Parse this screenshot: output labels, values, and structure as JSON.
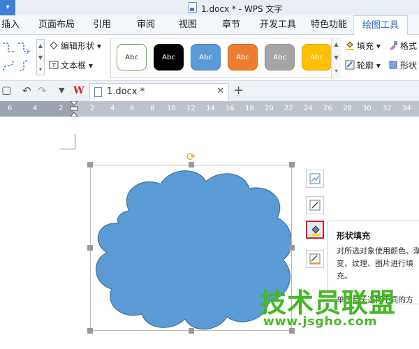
{
  "window": {
    "title": "1.docx * - WPS 文字"
  },
  "ribbon_tabs": [
    "插入",
    "页面布局",
    "引用",
    "审阅",
    "视图",
    "章节",
    "开发工具",
    "特色功能",
    "绘图工具"
  ],
  "active_tab": "绘图工具",
  "ribbon": {
    "edit_shape_label": "编辑形状",
    "textbox_label": "文本框",
    "fill_label": "填充",
    "format_label": "格式",
    "outline_label": "轮廓",
    "shape_effect_label": "形状",
    "style_samples": [
      {
        "label": "Abc",
        "fill": "#ffffff",
        "border": "#6aa84f",
        "text": "#333333"
      },
      {
        "label": "Abc",
        "fill": "#000000",
        "border": "#000000",
        "text": "#ffffff"
      },
      {
        "label": "Abc",
        "fill": "#5b9bd5",
        "border": "#4a86bf",
        "text": "#ffffff"
      },
      {
        "label": "Abc",
        "fill": "#ed7d31",
        "border": "#d66a20",
        "text": "#ffffff"
      },
      {
        "label": "Abc",
        "fill": "#a5a5a5",
        "border": "#8f8f8f",
        "text": "#ffffff"
      },
      {
        "label": "Abc",
        "fill": "#ffc000",
        "border": "#e0a800",
        "text": "#ffffff"
      }
    ]
  },
  "document_tab": {
    "name": "1.docx *"
  },
  "ruler": {
    "labels": [
      "6",
      "4",
      "2",
      "2",
      "4",
      "6",
      "8",
      "10",
      "12",
      "14",
      "16",
      "18",
      "20",
      "22",
      "24",
      "26",
      "28",
      "30",
      "32",
      "34"
    ]
  },
  "shape": {
    "fill_color": "#5b9bd5",
    "outline_color": "#41719c"
  },
  "tooltip": {
    "title": "形状填充",
    "description": "对所选对象使用颜色、渐变、纹理、图片进行填充。",
    "hint": "单击箭头选择不同的方"
  },
  "watermark": {
    "text": "技术员联盟",
    "url": "www.jsgho.com"
  },
  "colors": {
    "accent_blue": "#2f6fcf",
    "highlight_red": "#d62020",
    "watermark_green": "#43b823"
  }
}
